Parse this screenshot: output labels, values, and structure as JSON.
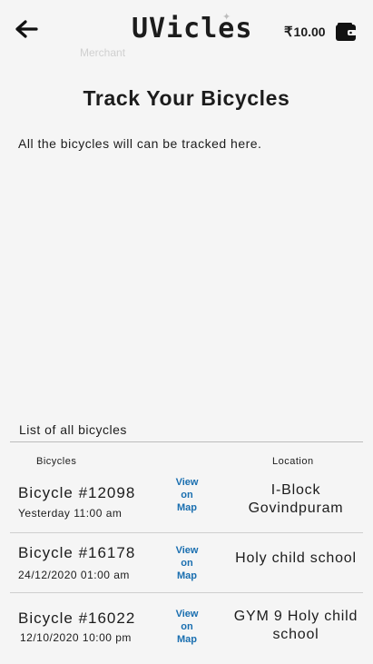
{
  "header": {
    "logo_text": "UVicles",
    "merchant_label": "Merchant",
    "balance_currency": "₹",
    "balance_amount": "10.00"
  },
  "page": {
    "title": "Track Your Bicycles",
    "subtitle": "All the bicycles will can be tracked here."
  },
  "list": {
    "title": "List of all bicycles",
    "col_bicycles": "Bicycles",
    "col_location": "Location",
    "rows": [
      {
        "name": "Bicycle #12098",
        "time": "Yesterday 11:00 am",
        "link": "View\non\nMap",
        "location": "I-Block Govindpuram"
      },
      {
        "name": "Bicycle #16178",
        "time": "24/12/2020 01:00 am",
        "link": "View\non\nMap",
        "location": "Holy child school"
      },
      {
        "name": "Bicycle #16022",
        "time": "12/10/2020 10:00 pm",
        "link": "View\non\nMap",
        "location": "GYM 9 Holy child school"
      }
    ]
  },
  "icons": {
    "back": "arrow-left-icon",
    "wallet": "wallet-icon",
    "sparkle": "sparkle-icon"
  },
  "colors": {
    "background": "#f5f5f5",
    "text": "#1c1c1c",
    "link": "#1a6fb0"
  }
}
